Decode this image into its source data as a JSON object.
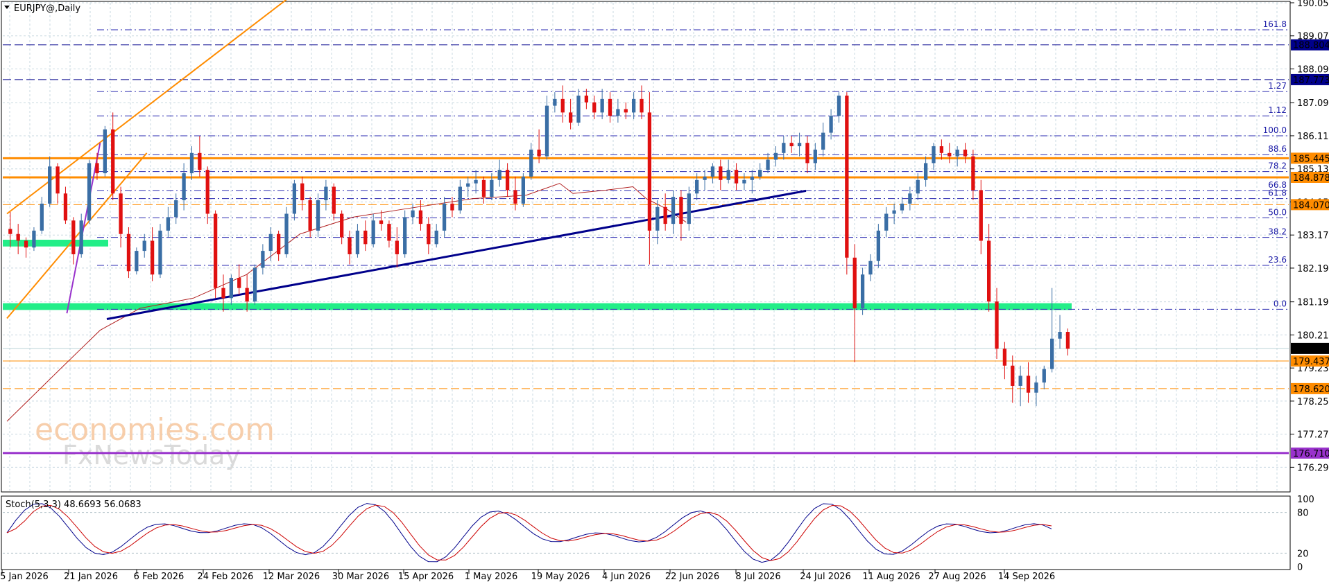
{
  "chart_data": {
    "type": "candlestick",
    "symbol_label": "EURJPY@,Daily",
    "watermark": [
      "economies.com",
      "FxNewsToday"
    ],
    "y_axis": {
      "ylim": [
        175.6,
        190.05
      ],
      "ticks": [
        "190.050",
        "189.070",
        "188.090",
        "187.090",
        "186.110",
        "185.130",
        "184.150",
        "183.170",
        "182.190",
        "181.190",
        "180.210",
        "179.230",
        "178.250",
        "177.270",
        "176.290"
      ]
    },
    "x_axis": {
      "labels": [
        "5 Jan 2026",
        "21 Jan 2026",
        "6 Feb 2026",
        "24 Feb 2026",
        "12 Mar 2026",
        "30 Mar 2026",
        "15 Apr 2026",
        "1 May 2026",
        "19 May 2026",
        "4 Jun 2026",
        "22 Jun 2026",
        "8 Jul 2026",
        "24 Jul 2026",
        "11 Aug 2026",
        "27 Aug 2026",
        "14 Sep 2026"
      ]
    },
    "price_levels": [
      {
        "label": "188.804",
        "value": 188.804,
        "color": "#00008b",
        "style": "dash"
      },
      {
        "label": "187.773",
        "value": 187.773,
        "color": "#00008b",
        "style": "dash"
      },
      {
        "label": "185.445",
        "value": 185.445,
        "color": "#ff8c00",
        "style": "thick"
      },
      {
        "label": "184.878",
        "value": 184.878,
        "color": "#ff8c00",
        "style": "thick"
      },
      {
        "label": "184.070",
        "value": 184.07,
        "color": "#ff8c00",
        "style": "dash"
      },
      {
        "label": "179.810",
        "value": 179.81,
        "color": "#000000",
        "style": "current"
      },
      {
        "label": "179.437",
        "value": 179.437,
        "color": "#ff8c00",
        "style": "solid"
      },
      {
        "label": "178.620",
        "value": 178.62,
        "color": "#ff8c00",
        "style": "dash"
      },
      {
        "label": "176.710",
        "value": 176.71,
        "color": "#9932cc",
        "style": "thick"
      }
    ],
    "fib_levels": [
      {
        "label": "161.8",
        "value": 189.25
      },
      {
        "label": "1.27",
        "value": 187.42
      },
      {
        "label": "1.12",
        "value": 186.7
      },
      {
        "label": "100.0",
        "value": 186.11
      },
      {
        "label": "88.6",
        "value": 185.55
      },
      {
        "label": "78.2",
        "value": 185.05
      },
      {
        "label": "66.8",
        "value": 184.49
      },
      {
        "label": "61.8",
        "value": 184.25
      },
      {
        "label": "50.0",
        "value": 183.68
      },
      {
        "label": "38.2",
        "value": 183.1
      },
      {
        "label": "23.6",
        "value": 182.27
      },
      {
        "label": "0.0",
        "value": 180.97
      }
    ],
    "zones": [
      {
        "name": "green-support-1",
        "from": 183.03,
        "to": 182.83
      },
      {
        "name": "green-support-2",
        "from": 181.15,
        "to": 180.95
      }
    ],
    "trendlines": [
      {
        "name": "blue-uptrend",
        "color": "#00008b",
        "points": [
          [
            15,
            180.68
          ],
          [
            120,
            184.48
          ]
        ]
      },
      {
        "name": "orange-channel-upper",
        "color": "#ff8c00",
        "points": [
          [
            0,
            183.8
          ],
          [
            43,
            190.3
          ]
        ]
      },
      {
        "name": "orange-channel-lower",
        "color": "#ff8c00",
        "points": [
          [
            0,
            180.7
          ],
          [
            21,
            185.6
          ]
        ]
      },
      {
        "name": "purple-rise",
        "color": "#9932cc",
        "points": [
          [
            9,
            180.85
          ],
          [
            14,
            185.9
          ]
        ]
      }
    ],
    "moving_average": {
      "color": "#b22222",
      "points": [
        [
          0,
          177.65
        ],
        [
          8,
          179.2
        ],
        [
          14,
          180.35
        ],
        [
          20,
          181
        ],
        [
          28,
          181.3
        ],
        [
          36,
          182
        ],
        [
          44,
          183.2
        ],
        [
          52,
          183.7
        ],
        [
          60,
          183.95
        ],
        [
          70,
          184.25
        ],
        [
          78,
          184.35
        ],
        [
          83,
          184.7
        ],
        [
          85,
          184.4
        ],
        [
          90,
          184.5
        ],
        [
          94,
          184.6
        ],
        [
          96,
          184.25
        ],
        [
          99,
          183.95
        ],
        [
          102,
          183.55
        ]
      ]
    },
    "candles": [
      [
        183.35,
        183.85,
        182.8,
        183.2
      ],
      [
        183.2,
        183.5,
        182.6,
        183.0
      ],
      [
        183.0,
        183.1,
        182.5,
        182.8
      ],
      [
        182.8,
        183.4,
        182.7,
        183.3
      ],
      [
        183.3,
        184.3,
        183.2,
        184.1
      ],
      [
        184.1,
        185.5,
        184.0,
        185.2
      ],
      [
        185.2,
        185.3,
        184.1,
        184.4
      ],
      [
        184.4,
        184.6,
        183.5,
        183.6
      ],
      [
        183.6,
        183.7,
        182.3,
        182.6
      ],
      [
        182.6,
        183.8,
        182.5,
        183.6
      ],
      [
        183.6,
        185.4,
        183.5,
        185.3
      ],
      [
        185.3,
        185.6,
        184.8,
        185.0
      ],
      [
        185.0,
        186.4,
        184.9,
        186.3
      ],
      [
        186.3,
        186.8,
        184.2,
        184.4
      ],
      [
        184.4,
        184.6,
        182.8,
        183.2
      ],
      [
        183.2,
        183.4,
        181.9,
        182.1
      ],
      [
        182.1,
        182.8,
        182.0,
        182.7
      ],
      [
        182.7,
        183.2,
        182.5,
        183.0
      ],
      [
        183.0,
        183.4,
        181.8,
        182.0
      ],
      [
        182.0,
        183.5,
        181.9,
        183.3
      ],
      [
        183.3,
        184.0,
        183.1,
        183.7
      ],
      [
        183.7,
        184.4,
        183.5,
        184.2
      ],
      [
        184.2,
        185.3,
        183.9,
        185.0
      ],
      [
        185.0,
        185.8,
        184.8,
        185.6
      ],
      [
        185.6,
        186.1,
        184.9,
        185.1
      ],
      [
        185.1,
        185.2,
        183.5,
        183.8
      ],
      [
        183.8,
        183.9,
        181.3,
        181.6
      ],
      [
        181.6,
        182.0,
        180.9,
        181.3
      ],
      [
        181.3,
        182.0,
        181.1,
        181.9
      ],
      [
        181.9,
        182.3,
        181.4,
        181.6
      ],
      [
        181.6,
        182.0,
        180.9,
        181.2
      ],
      [
        181.2,
        182.3,
        181.1,
        182.2
      ],
      [
        182.2,
        182.9,
        182.0,
        182.7
      ],
      [
        182.7,
        183.4,
        182.4,
        183.2
      ],
      [
        183.2,
        183.3,
        182.4,
        182.6
      ],
      [
        182.6,
        184.0,
        182.5,
        183.8
      ],
      [
        183.8,
        184.8,
        183.6,
        184.7
      ],
      [
        184.7,
        184.9,
        183.9,
        184.2
      ],
      [
        184.2,
        184.3,
        183.1,
        183.3
      ],
      [
        183.3,
        184.4,
        183.1,
        184.2
      ],
      [
        184.2,
        184.8,
        183.9,
        184.6
      ],
      [
        184.6,
        184.7,
        183.6,
        183.8
      ],
      [
        183.8,
        183.9,
        182.9,
        183.1
      ],
      [
        183.1,
        183.3,
        182.3,
        182.6
      ],
      [
        182.6,
        183.5,
        182.5,
        183.3
      ],
      [
        183.3,
        183.6,
        182.7,
        182.9
      ],
      [
        182.9,
        183.8,
        182.8,
        183.6
      ],
      [
        183.6,
        183.9,
        183.3,
        183.5
      ],
      [
        183.5,
        183.6,
        182.8,
        183.0
      ],
      [
        183.0,
        183.4,
        182.2,
        182.6
      ],
      [
        182.6,
        183.9,
        182.5,
        183.7
      ],
      [
        183.7,
        184.1,
        183.5,
        183.9
      ],
      [
        183.9,
        184.2,
        183.3,
        183.5
      ],
      [
        183.5,
        183.7,
        182.6,
        182.9
      ],
      [
        182.9,
        183.5,
        182.8,
        183.3
      ],
      [
        183.3,
        184.3,
        183.1,
        184.1
      ],
      [
        184.1,
        184.3,
        183.7,
        183.9
      ],
      [
        183.9,
        184.8,
        183.8,
        184.6
      ],
      [
        184.6,
        184.9,
        184.3,
        184.7
      ],
      [
        184.7,
        185.1,
        184.4,
        184.8
      ],
      [
        184.8,
        184.9,
        184.1,
        184.3
      ],
      [
        184.3,
        185.0,
        184.2,
        184.8
      ],
      [
        184.8,
        185.4,
        184.6,
        185.1
      ],
      [
        185.1,
        185.3,
        184.3,
        184.5
      ],
      [
        184.5,
        184.9,
        183.9,
        184.1
      ],
      [
        184.1,
        185.0,
        184.0,
        184.9
      ],
      [
        184.9,
        185.9,
        184.8,
        185.7
      ],
      [
        185.7,
        186.3,
        185.3,
        185.5
      ],
      [
        185.5,
        187.3,
        185.4,
        187.0
      ],
      [
        187.0,
        187.4,
        186.8,
        187.2
      ],
      [
        187.2,
        187.6,
        186.5,
        186.8
      ],
      [
        186.8,
        187.2,
        186.3,
        186.5
      ],
      [
        186.5,
        187.5,
        186.4,
        187.3
      ],
      [
        187.3,
        187.5,
        186.9,
        187.1
      ],
      [
        187.1,
        187.3,
        186.6,
        186.8
      ],
      [
        186.8,
        187.5,
        186.6,
        187.2
      ],
      [
        187.2,
        187.4,
        186.5,
        186.7
      ],
      [
        186.7,
        187.2,
        186.5,
        186.9
      ],
      [
        186.9,
        187.1,
        186.6,
        186.8
      ],
      [
        186.8,
        187.4,
        186.6,
        187.2
      ],
      [
        187.2,
        187.6,
        186.6,
        186.8
      ],
      [
        186.8,
        187.4,
        182.3,
        183.3
      ],
      [
        183.3,
        184.2,
        182.9,
        184.0
      ],
      [
        184.0,
        184.4,
        183.3,
        183.5
      ],
      [
        183.5,
        184.5,
        183.2,
        184.3
      ],
      [
        184.3,
        184.5,
        183.0,
        183.5
      ],
      [
        183.5,
        184.6,
        183.3,
        184.4
      ],
      [
        184.4,
        185.0,
        184.2,
        184.8
      ],
      [
        184.8,
        185.1,
        184.5,
        184.9
      ],
      [
        184.9,
        185.3,
        184.7,
        185.2
      ],
      [
        185.2,
        185.4,
        184.5,
        184.8
      ],
      [
        184.8,
        185.4,
        184.7,
        185.1
      ],
      [
        185.1,
        185.3,
        184.5,
        184.7
      ],
      [
        184.7,
        185.0,
        184.5,
        184.8
      ],
      [
        184.8,
        185.1,
        184.4,
        184.9
      ],
      [
        184.9,
        185.3,
        184.8,
        185.1
      ],
      [
        185.1,
        185.6,
        185.0,
        185.4
      ],
      [
        185.4,
        185.8,
        185.2,
        185.6
      ],
      [
        185.6,
        186.1,
        185.4,
        185.9
      ],
      [
        185.9,
        186.1,
        185.6,
        185.8
      ]
    ],
    "stochastic": {
      "label": "Stoch(5,3,3) 48.6693 56.0683",
      "ylim": [
        0,
        100
      ],
      "ticks": [
        "100",
        "80",
        "20",
        "0"
      ]
    },
    "grid": true
  }
}
